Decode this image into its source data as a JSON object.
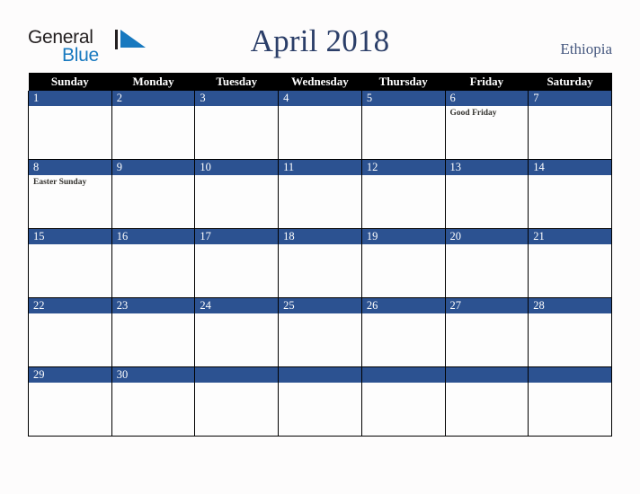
{
  "brand": {
    "word_one": "General",
    "word_two": "Blue",
    "mark": "triangle-logo-mark"
  },
  "header": {
    "title": "April 2018",
    "country": "Ethiopia"
  },
  "calendar": {
    "weekday_headers": [
      "Sunday",
      "Monday",
      "Tuesday",
      "Wednesday",
      "Thursday",
      "Friday",
      "Saturday"
    ],
    "weeks": [
      [
        {
          "day": "1",
          "events": []
        },
        {
          "day": "2",
          "events": []
        },
        {
          "day": "3",
          "events": []
        },
        {
          "day": "4",
          "events": []
        },
        {
          "day": "5",
          "events": []
        },
        {
          "day": "6",
          "events": [
            "Good Friday"
          ]
        },
        {
          "day": "7",
          "events": []
        }
      ],
      [
        {
          "day": "8",
          "events": [
            "Easter Sunday"
          ]
        },
        {
          "day": "9",
          "events": []
        },
        {
          "day": "10",
          "events": []
        },
        {
          "day": "11",
          "events": []
        },
        {
          "day": "12",
          "events": []
        },
        {
          "day": "13",
          "events": []
        },
        {
          "day": "14",
          "events": []
        }
      ],
      [
        {
          "day": "15",
          "events": []
        },
        {
          "day": "16",
          "events": []
        },
        {
          "day": "17",
          "events": []
        },
        {
          "day": "18",
          "events": []
        },
        {
          "day": "19",
          "events": []
        },
        {
          "day": "20",
          "events": []
        },
        {
          "day": "21",
          "events": []
        }
      ],
      [
        {
          "day": "22",
          "events": []
        },
        {
          "day": "23",
          "events": []
        },
        {
          "day": "24",
          "events": []
        },
        {
          "day": "25",
          "events": []
        },
        {
          "day": "26",
          "events": []
        },
        {
          "day": "27",
          "events": []
        },
        {
          "day": "28",
          "events": []
        }
      ],
      [
        {
          "day": "29",
          "events": []
        },
        {
          "day": "30",
          "events": []
        },
        {
          "day": "",
          "events": []
        },
        {
          "day": "",
          "events": []
        },
        {
          "day": "",
          "events": []
        },
        {
          "day": "",
          "events": []
        },
        {
          "day": "",
          "events": []
        }
      ]
    ]
  },
  "colors": {
    "day_band_blue": "#2c5291",
    "header_black": "#000000",
    "title_navy": "#2b3e68",
    "country_navy": "#46587f",
    "logo_blue": "#1879bf",
    "page_background": "#fdfcfc"
  }
}
